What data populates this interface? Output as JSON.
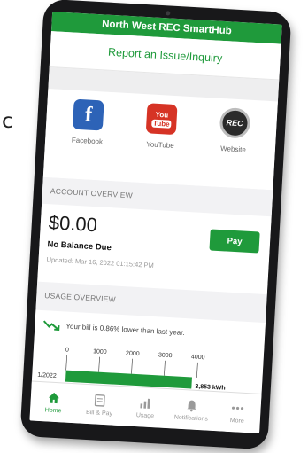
{
  "edge_text": "c",
  "app": {
    "title": "North West REC SmartHub",
    "report_link": "Report an Issue/Inquiry"
  },
  "social": [
    {
      "label": "Facebook",
      "icon": "facebook-icon"
    },
    {
      "label": "YouTube",
      "icon": "youtube-icon",
      "glyph_top": "You",
      "glyph_bottom": "Tube"
    },
    {
      "label": "Website",
      "icon": "rec-logo-icon",
      "glyph": "REC"
    }
  ],
  "account": {
    "header": "ACCOUNT OVERVIEW",
    "balance": "$0.00",
    "status": "No Balance Due",
    "updated": "Updated: Mar 16, 2022 01:15:42 PM",
    "pay_label": "Pay"
  },
  "usage": {
    "header": "USAGE OVERVIEW",
    "trend_text": "Your bill is 0.86% lower than last year.",
    "trend_icon": "trend-down-icon"
  },
  "chart_data": {
    "type": "bar",
    "orientation": "horizontal",
    "categories": [
      "1/2022"
    ],
    "values": [
      3853
    ],
    "value_labels": [
      "3,853 kWh"
    ],
    "x_ticks": [
      0,
      1000,
      2000,
      3000,
      4000
    ],
    "xlim": [
      0,
      4000
    ],
    "color": "#1f9a3b"
  },
  "tabs": [
    {
      "label": "Home",
      "icon": "home-icon",
      "active": true
    },
    {
      "label": "Bill & Pay",
      "icon": "bill-icon",
      "active": false
    },
    {
      "label": "Usage",
      "icon": "usage-chart-icon",
      "active": false
    },
    {
      "label": "Notifications",
      "icon": "bell-icon",
      "active": false
    },
    {
      "label": "More",
      "icon": "more-dots-icon",
      "active": false
    }
  ],
  "colors": {
    "brand_green": "#1f9a3b",
    "device_frame": "#18181a",
    "facebook_blue": "#2d63b7",
    "youtube_red": "#d63325"
  }
}
